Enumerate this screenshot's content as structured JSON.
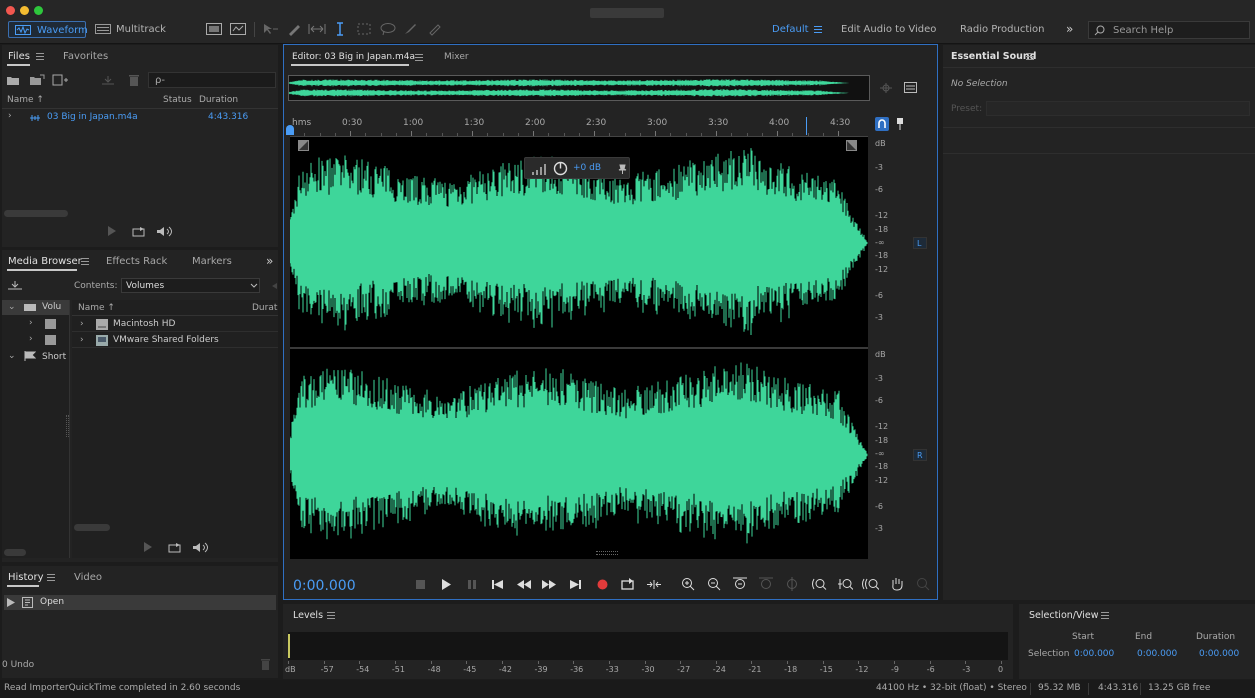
{
  "toolbar": {
    "waveform_label": "Waveform",
    "multitrack_label": "Multitrack",
    "workspace_default": "Default",
    "workspace_edit_video": "Edit Audio to Video",
    "workspace_radio": "Radio Production",
    "search_placeholder": "Search Help"
  },
  "files_panel": {
    "tab_files": "Files",
    "tab_favorites": "Favorites",
    "search_value": "ρ-",
    "col_name": "Name ↑",
    "col_status": "Status",
    "col_duration": "Duration",
    "file_name": "03 Big in Japan.m4a",
    "file_duration": "4:43.316"
  },
  "media_browser": {
    "tab_media": "Media Browser",
    "tab_effects": "Effects Rack",
    "tab_markers": "Markers",
    "contents_label": "Contents:",
    "contents_value": "Volumes",
    "tree_volumes": "Volu",
    "tree_shortcuts": "Short",
    "col_name": "Name ↑",
    "col_duration": "Durat",
    "items": [
      "Macintosh HD",
      "VMware Shared Folders"
    ]
  },
  "history": {
    "tab_history": "History",
    "tab_video": "Video",
    "item_open": "Open",
    "undo_count": "0 Undo"
  },
  "editor": {
    "tab_editor": "Editor: 03 Big in Japan.m4a",
    "tab_mixer": "Mixer",
    "time_unit": "hms",
    "ruler_ticks": [
      "0:30",
      "1:00",
      "1:30",
      "2:00",
      "2:30",
      "3:00",
      "3:30",
      "4:00",
      "4:30"
    ],
    "hud_gain": "+0 dB",
    "db_scale": [
      "dB",
      "-3",
      "-6",
      "-12",
      "-18",
      "-∞",
      "-18",
      "-12",
      "-6",
      "-3"
    ],
    "channel_left": "L",
    "channel_right": "R",
    "current_time": "0:00.000",
    "waveform_color": "#3ed69a"
  },
  "essential_sound": {
    "title": "Essential Sound",
    "no_selection": "No Selection",
    "preset_label": "Preset:"
  },
  "levels": {
    "title": "Levels",
    "scale": [
      "dB",
      "-57",
      "-54",
      "-51",
      "-48",
      "-45",
      "-42",
      "-39",
      "-36",
      "-33",
      "-30",
      "-27",
      "-24",
      "-21",
      "-18",
      "-15",
      "-12",
      "-9",
      "-6",
      "-3",
      "0"
    ]
  },
  "selection_view": {
    "title": "Selection/View",
    "col_start": "Start",
    "col_end": "End",
    "col_duration": "Duration",
    "row_label": "Selection",
    "start": "0:00.000",
    "end": "0:00.000",
    "duration": "0:00.000"
  },
  "status_bar": {
    "message": "Read ImporterQuickTime completed in 2.60 seconds",
    "format": "44100 Hz • 32-bit (float) • Stereo",
    "size": "95.32 MB",
    "duration": "4:43.316",
    "free": "13.25 GB free"
  },
  "colors": {
    "accent_blue": "#4a9cf5",
    "record_red": "#e23b3b",
    "waveform_green": "#3ed69a",
    "panel_bg": "#232323",
    "app_bg": "#1c1c1c"
  }
}
